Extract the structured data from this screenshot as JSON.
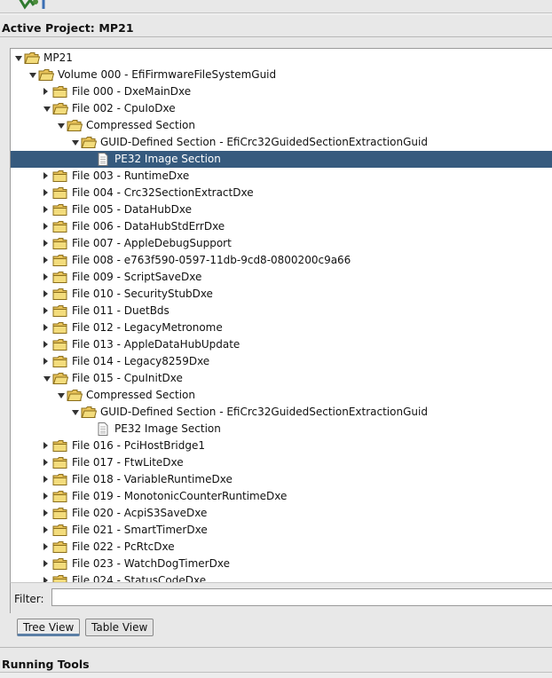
{
  "project_title": "Active Project: MP21",
  "tree": {
    "rows": [
      {
        "label": "MP21",
        "depth": 0,
        "type": "folder",
        "state": "expanded"
      },
      {
        "label": "Volume 000 - EfiFirmwareFileSystemGuid",
        "depth": 1,
        "type": "folder",
        "state": "expanded"
      },
      {
        "label": "File 000 - DxeMainDxe",
        "depth": 2,
        "type": "folder",
        "state": "collapsed"
      },
      {
        "label": "File 002 - CpuIoDxe",
        "depth": 2,
        "type": "folder",
        "state": "expanded"
      },
      {
        "label": "Compressed Section",
        "depth": 3,
        "type": "folder",
        "state": "expanded"
      },
      {
        "label": "GUID-Defined Section - EfiCrc32GuidedSectionExtractionGuid",
        "depth": 4,
        "type": "folder",
        "state": "expanded"
      },
      {
        "label": "PE32 Image Section",
        "depth": 5,
        "type": "file",
        "state": "leaf",
        "selected": true
      },
      {
        "label": "File 003 - RuntimeDxe",
        "depth": 2,
        "type": "folder",
        "state": "collapsed"
      },
      {
        "label": "File 004 - Crc32SectionExtractDxe",
        "depth": 2,
        "type": "folder",
        "state": "collapsed"
      },
      {
        "label": "File 005 - DataHubDxe",
        "depth": 2,
        "type": "folder",
        "state": "collapsed"
      },
      {
        "label": "File 006 - DataHubStdErrDxe",
        "depth": 2,
        "type": "folder",
        "state": "collapsed"
      },
      {
        "label": "File 007 - AppleDebugSupport",
        "depth": 2,
        "type": "folder",
        "state": "collapsed"
      },
      {
        "label": "File 008 - e763f590-0597-11db-9cd8-0800200c9a66",
        "depth": 2,
        "type": "folder",
        "state": "collapsed"
      },
      {
        "label": "File 009 - ScriptSaveDxe",
        "depth": 2,
        "type": "folder",
        "state": "collapsed"
      },
      {
        "label": "File 010 - SecurityStubDxe",
        "depth": 2,
        "type": "folder",
        "state": "collapsed"
      },
      {
        "label": "File 011 - DuetBds",
        "depth": 2,
        "type": "folder",
        "state": "collapsed"
      },
      {
        "label": "File 012 - LegacyMetronome",
        "depth": 2,
        "type": "folder",
        "state": "collapsed"
      },
      {
        "label": "File 013 - AppleDataHubUpdate",
        "depth": 2,
        "type": "folder",
        "state": "collapsed"
      },
      {
        "label": "File 014 - Legacy8259Dxe",
        "depth": 2,
        "type": "folder",
        "state": "collapsed"
      },
      {
        "label": "File 015 - CpuInitDxe",
        "depth": 2,
        "type": "folder",
        "state": "expanded"
      },
      {
        "label": "Compressed Section",
        "depth": 3,
        "type": "folder",
        "state": "expanded"
      },
      {
        "label": "GUID-Defined Section - EfiCrc32GuidedSectionExtractionGuid",
        "depth": 4,
        "type": "folder",
        "state": "expanded"
      },
      {
        "label": "PE32 Image Section",
        "depth": 5,
        "type": "file",
        "state": "leaf"
      },
      {
        "label": "File 016 - PciHostBridge1",
        "depth": 2,
        "type": "folder",
        "state": "collapsed"
      },
      {
        "label": "File 017 - FtwLiteDxe",
        "depth": 2,
        "type": "folder",
        "state": "collapsed"
      },
      {
        "label": "File 018 - VariableRuntimeDxe",
        "depth": 2,
        "type": "folder",
        "state": "collapsed"
      },
      {
        "label": "File 019 - MonotonicCounterRuntimeDxe",
        "depth": 2,
        "type": "folder",
        "state": "collapsed"
      },
      {
        "label": "File 020 - AcpiS3SaveDxe",
        "depth": 2,
        "type": "folder",
        "state": "collapsed"
      },
      {
        "label": "File 021 - SmartTimerDxe",
        "depth": 2,
        "type": "folder",
        "state": "collapsed"
      },
      {
        "label": "File 022 - PcRtcDxe",
        "depth": 2,
        "type": "folder",
        "state": "collapsed"
      },
      {
        "label": "File 023 - WatchDogTimerDxe",
        "depth": 2,
        "type": "folder",
        "state": "collapsed"
      },
      {
        "label": "File 024 - StatusCodeDxe",
        "depth": 2,
        "type": "folder",
        "state": "collapsed"
      }
    ]
  },
  "filter": {
    "label": "Filter:",
    "value": ""
  },
  "tabs": [
    {
      "label": "Tree View",
      "active": true
    },
    {
      "label": "Table View",
      "active": false
    }
  ],
  "running_tools_title": "Running Tools",
  "colors": {
    "selection": "#365a7e",
    "folder_fill": "#f3dc7c",
    "folder_stroke": "#8a6d1a"
  }
}
